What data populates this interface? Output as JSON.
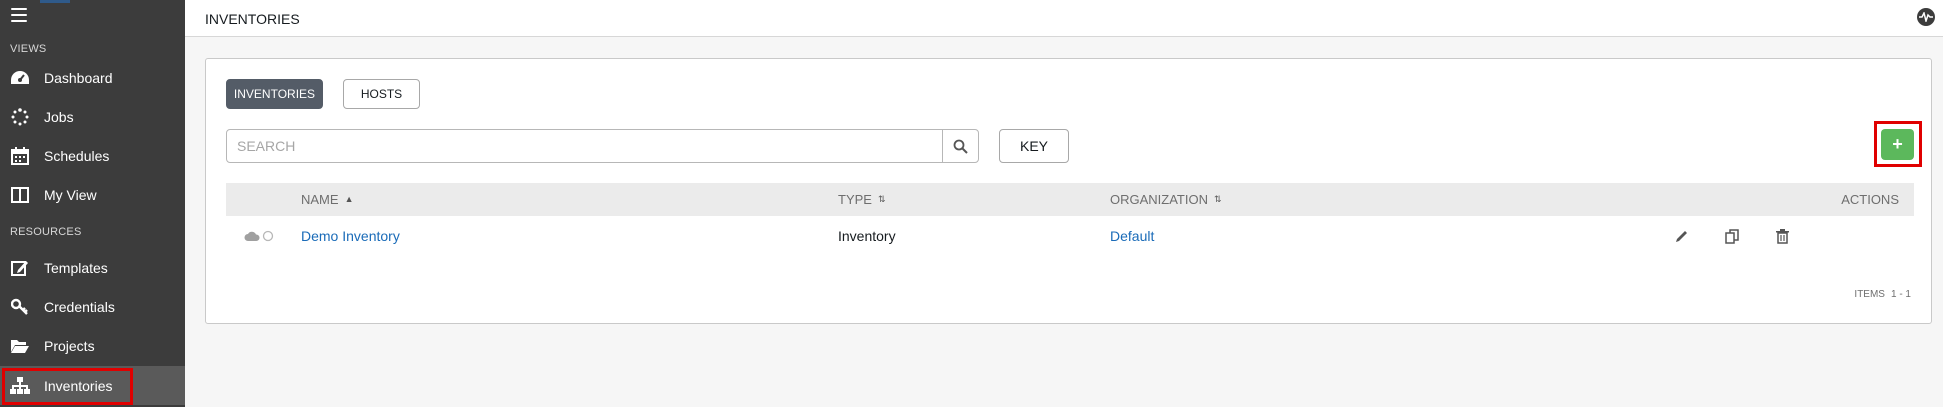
{
  "sidebar": {
    "views_label": "VIEWS",
    "resources_label": "RESOURCES",
    "items": [
      {
        "label": "Dashboard",
        "icon": "dashboard-icon"
      },
      {
        "label": "Jobs",
        "icon": "jobs-spinner-icon"
      },
      {
        "label": "Schedules",
        "icon": "calendar-icon"
      },
      {
        "label": "My View",
        "icon": "columns-icon"
      },
      {
        "label": "Templates",
        "icon": "edit-icon"
      },
      {
        "label": "Credentials",
        "icon": "key-icon"
      },
      {
        "label": "Projects",
        "icon": "folder-open-icon"
      },
      {
        "label": "Inventories",
        "icon": "sitemap-icon",
        "active": true
      }
    ]
  },
  "header": {
    "title": "INVENTORIES"
  },
  "tabs": [
    {
      "label": "INVENTORIES",
      "selected": true
    },
    {
      "label": "HOSTS",
      "selected": false
    }
  ],
  "search": {
    "placeholder": "SEARCH",
    "key_label": "KEY"
  },
  "add_button": {
    "label": "+",
    "color": "#5cb85c"
  },
  "table": {
    "columns": [
      {
        "label": "NAME",
        "sort": "▲"
      },
      {
        "label": "TYPE",
        "sort": "⇅"
      },
      {
        "label": "ORGANIZATION",
        "sort": "⇅"
      },
      {
        "label": "ACTIONS"
      }
    ],
    "rows": [
      {
        "name": "Demo Inventory",
        "type": "Inventory",
        "organization": "Default"
      }
    ]
  },
  "pagination": {
    "label": "ITEMS",
    "range": "1 - 1"
  },
  "colors": {
    "sidebar_bg": "#3c3c3c",
    "active_item_bg": "#5a5a5a",
    "link": "#1a6bb8",
    "highlight": "#e00000",
    "selected_tab": "#545c67"
  }
}
